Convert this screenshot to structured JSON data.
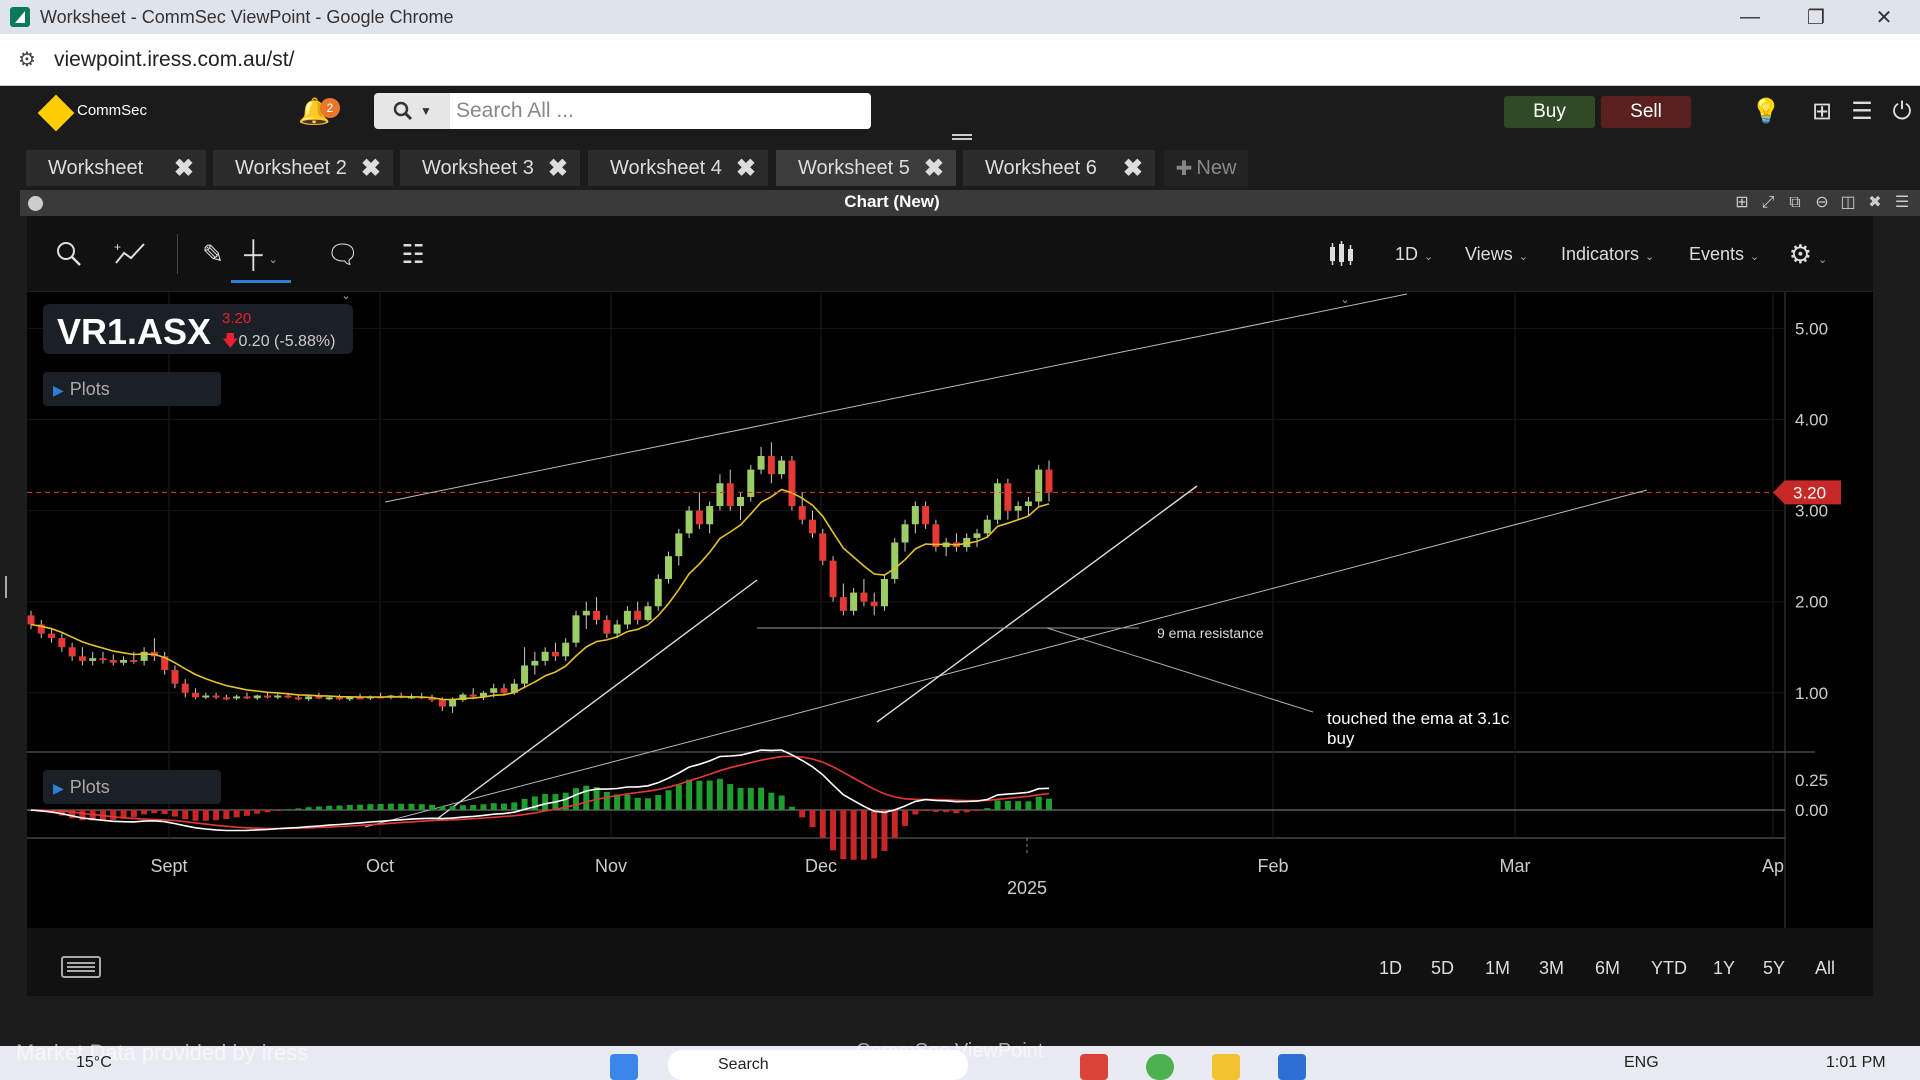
{
  "window": {
    "title": "Worksheet - CommSec ViewPoint - Google Chrome",
    "minimize": "—",
    "restore": "❐",
    "close": "✕"
  },
  "browser": {
    "url": "viewpoint.iress.com.au/st/"
  },
  "appbar": {
    "logo_text": "CommSec",
    "notification_count": "2",
    "search_placeholder": "Search All ...",
    "buy_label": "Buy",
    "sell_label": "Sell"
  },
  "tabs": [
    {
      "label": "Worksheet"
    },
    {
      "label": "Worksheet 2"
    },
    {
      "label": "Worksheet 3"
    },
    {
      "label": "Worksheet 4"
    },
    {
      "label": "Worksheet 5",
      "active": true
    },
    {
      "label": "Worksheet 6"
    }
  ],
  "new_tab_label": "New",
  "panel": {
    "title": "Chart (New)"
  },
  "toolbar": {
    "interval": "1D",
    "views": "Views",
    "indicators": "Indicators",
    "events": "Events"
  },
  "symbol": {
    "code": "VR1.ASX",
    "price": "3.20",
    "change": "0.20 (-5.88%)"
  },
  "plots_label": "Plots",
  "chart_data": {
    "type": "candlestick",
    "y_axis_ticks": [
      "5.00",
      "4.00",
      "3.00",
      "2.00",
      "1.00"
    ],
    "ylim": [
      0.35,
      5.4
    ],
    "indicator_ticks": [
      "0.25",
      "0.00"
    ],
    "x_axis_ticks": [
      "Sept",
      "Oct",
      "Nov",
      "Dec",
      "2025",
      "Feb",
      "Mar",
      "Ap"
    ],
    "current_price_label": "3.20",
    "current_price": 3.2,
    "annotations": [
      {
        "text": "9 ema resistance"
      },
      {
        "text_line1": "touched the ema at 3.1c",
        "text_line2": "buy"
      }
    ],
    "candles": [
      [
        1.85,
        1.9,
        1.7,
        1.75
      ],
      [
        1.75,
        1.8,
        1.6,
        1.65
      ],
      [
        1.65,
        1.7,
        1.55,
        1.6
      ],
      [
        1.6,
        1.65,
        1.45,
        1.5
      ],
      [
        1.5,
        1.55,
        1.35,
        1.4
      ],
      [
        1.4,
        1.5,
        1.3,
        1.35
      ],
      [
        1.35,
        1.45,
        1.3,
        1.38
      ],
      [
        1.38,
        1.45,
        1.32,
        1.36
      ],
      [
        1.36,
        1.42,
        1.3,
        1.33
      ],
      [
        1.33,
        1.4,
        1.3,
        1.36
      ],
      [
        1.36,
        1.45,
        1.32,
        1.35
      ],
      [
        1.35,
        1.5,
        1.3,
        1.45
      ],
      [
        1.45,
        1.6,
        1.35,
        1.4
      ],
      [
        1.4,
        1.45,
        1.2,
        1.25
      ],
      [
        1.25,
        1.3,
        1.05,
        1.1
      ],
      [
        1.1,
        1.15,
        0.95,
        1.0
      ],
      [
        1.0,
        1.05,
        0.93,
        0.95
      ],
      [
        0.95,
        1.0,
        0.93,
        0.97
      ],
      [
        0.97,
        1.0,
        0.93,
        0.95
      ],
      [
        0.95,
        0.98,
        0.92,
        0.94
      ],
      [
        0.94,
        0.98,
        0.92,
        0.96
      ],
      [
        0.96,
        1.0,
        0.93,
        0.94
      ],
      [
        0.94,
        0.98,
        0.92,
        0.97
      ],
      [
        0.97,
        1.0,
        0.94,
        0.95
      ],
      [
        0.95,
        0.99,
        0.93,
        0.97
      ],
      [
        0.97,
        1.0,
        0.94,
        0.95
      ],
      [
        0.95,
        0.98,
        0.92,
        0.93
      ],
      [
        0.93,
        0.97,
        0.91,
        0.96
      ],
      [
        0.96,
        1.0,
        0.93,
        0.94
      ],
      [
        0.94,
        0.97,
        0.92,
        0.95
      ],
      [
        0.95,
        0.98,
        0.92,
        0.93
      ],
      [
        0.93,
        0.96,
        0.91,
        0.95
      ],
      [
        0.95,
        0.99,
        0.93,
        0.94
      ],
      [
        0.94,
        0.97,
        0.92,
        0.96
      ],
      [
        0.96,
        1.0,
        0.94,
        0.95
      ],
      [
        0.95,
        0.98,
        0.93,
        0.97
      ],
      [
        0.97,
        1.0,
        0.94,
        0.95
      ],
      [
        0.95,
        0.99,
        0.93,
        0.96
      ],
      [
        0.96,
        1.0,
        0.93,
        0.94
      ],
      [
        0.94,
        0.98,
        0.9,
        0.92
      ],
      [
        0.92,
        0.95,
        0.8,
        0.85
      ],
      [
        0.85,
        0.95,
        0.78,
        0.92
      ],
      [
        0.92,
        1.0,
        0.9,
        0.98
      ],
      [
        0.98,
        1.05,
        0.93,
        0.96
      ],
      [
        0.96,
        1.02,
        0.92,
        1.0
      ],
      [
        1.0,
        1.1,
        0.95,
        1.05
      ],
      [
        1.05,
        1.1,
        0.98,
        1.0
      ],
      [
        1.0,
        1.15,
        0.98,
        1.1
      ],
      [
        1.1,
        1.5,
        1.05,
        1.3
      ],
      [
        1.3,
        1.45,
        1.2,
        1.35
      ],
      [
        1.35,
        1.5,
        1.3,
        1.45
      ],
      [
        1.45,
        1.55,
        1.35,
        1.4
      ],
      [
        1.4,
        1.6,
        1.35,
        1.55
      ],
      [
        1.55,
        1.9,
        1.5,
        1.85
      ],
      [
        1.85,
        2.0,
        1.7,
        1.9
      ],
      [
        1.9,
        2.05,
        1.75,
        1.8
      ],
      [
        1.8,
        1.85,
        1.6,
        1.65
      ],
      [
        1.65,
        1.8,
        1.6,
        1.75
      ],
      [
        1.75,
        1.95,
        1.7,
        1.9
      ],
      [
        1.9,
        2.0,
        1.75,
        1.8
      ],
      [
        1.8,
        2.0,
        1.78,
        1.95
      ],
      [
        1.95,
        2.3,
        1.9,
        2.25
      ],
      [
        2.25,
        2.55,
        2.2,
        2.5
      ],
      [
        2.5,
        2.8,
        2.4,
        2.75
      ],
      [
        2.75,
        3.05,
        2.7,
        3.0
      ],
      [
        3.0,
        3.2,
        2.8,
        2.85
      ],
      [
        2.85,
        3.1,
        2.75,
        3.05
      ],
      [
        3.05,
        3.4,
        3.0,
        3.3
      ],
      [
        3.3,
        3.45,
        3.0,
        3.05
      ],
      [
        3.05,
        3.2,
        2.9,
        3.15
      ],
      [
        3.15,
        3.5,
        3.1,
        3.45
      ],
      [
        3.45,
        3.7,
        3.4,
        3.6
      ],
      [
        3.6,
        3.75,
        3.3,
        3.4
      ],
      [
        3.4,
        3.6,
        3.35,
        3.55
      ],
      [
        3.55,
        3.6,
        3.0,
        3.05
      ],
      [
        3.05,
        3.2,
        2.85,
        2.9
      ],
      [
        2.9,
        3.0,
        2.7,
        2.75
      ],
      [
        2.75,
        2.8,
        2.4,
        2.45
      ],
      [
        2.45,
        2.5,
        2.0,
        2.05
      ],
      [
        2.05,
        2.2,
        1.85,
        1.9
      ],
      [
        1.9,
        2.15,
        1.85,
        2.1
      ],
      [
        2.1,
        2.25,
        1.95,
        2.0
      ],
      [
        2.0,
        2.1,
        1.85,
        1.95
      ],
      [
        1.95,
        2.3,
        1.9,
        2.25
      ],
      [
        2.25,
        2.7,
        2.2,
        2.65
      ],
      [
        2.65,
        2.9,
        2.55,
        2.85
      ],
      [
        2.85,
        3.1,
        2.75,
        3.05
      ],
      [
        3.05,
        3.1,
        2.8,
        2.85
      ],
      [
        2.85,
        2.9,
        2.55,
        2.6
      ],
      [
        2.6,
        2.7,
        2.5,
        2.65
      ],
      [
        2.65,
        2.75,
        2.55,
        2.6
      ],
      [
        2.6,
        2.75,
        2.55,
        2.7
      ],
      [
        2.7,
        2.8,
        2.6,
        2.75
      ],
      [
        2.75,
        2.95,
        2.7,
        2.9
      ],
      [
        2.9,
        3.35,
        2.85,
        3.3
      ],
      [
        3.3,
        3.35,
        2.9,
        3.0
      ],
      [
        3.0,
        3.1,
        2.9,
        3.05
      ],
      [
        3.05,
        3.15,
        2.95,
        3.1
      ],
      [
        3.1,
        3.5,
        3.05,
        3.45
      ],
      [
        3.45,
        3.55,
        3.1,
        3.2
      ]
    ]
  },
  "range_buttons": [
    "1D",
    "5D",
    "1M",
    "3M",
    "6M",
    "YTD",
    "1Y",
    "5Y",
    "All"
  ],
  "taskbar": {
    "weather": "15°C",
    "search": "Search",
    "lang": "ENG",
    "time": "1:01 PM",
    "overlay_left": "Market Data provided by iress",
    "overlay_center": "CommSec ViewPoint"
  }
}
